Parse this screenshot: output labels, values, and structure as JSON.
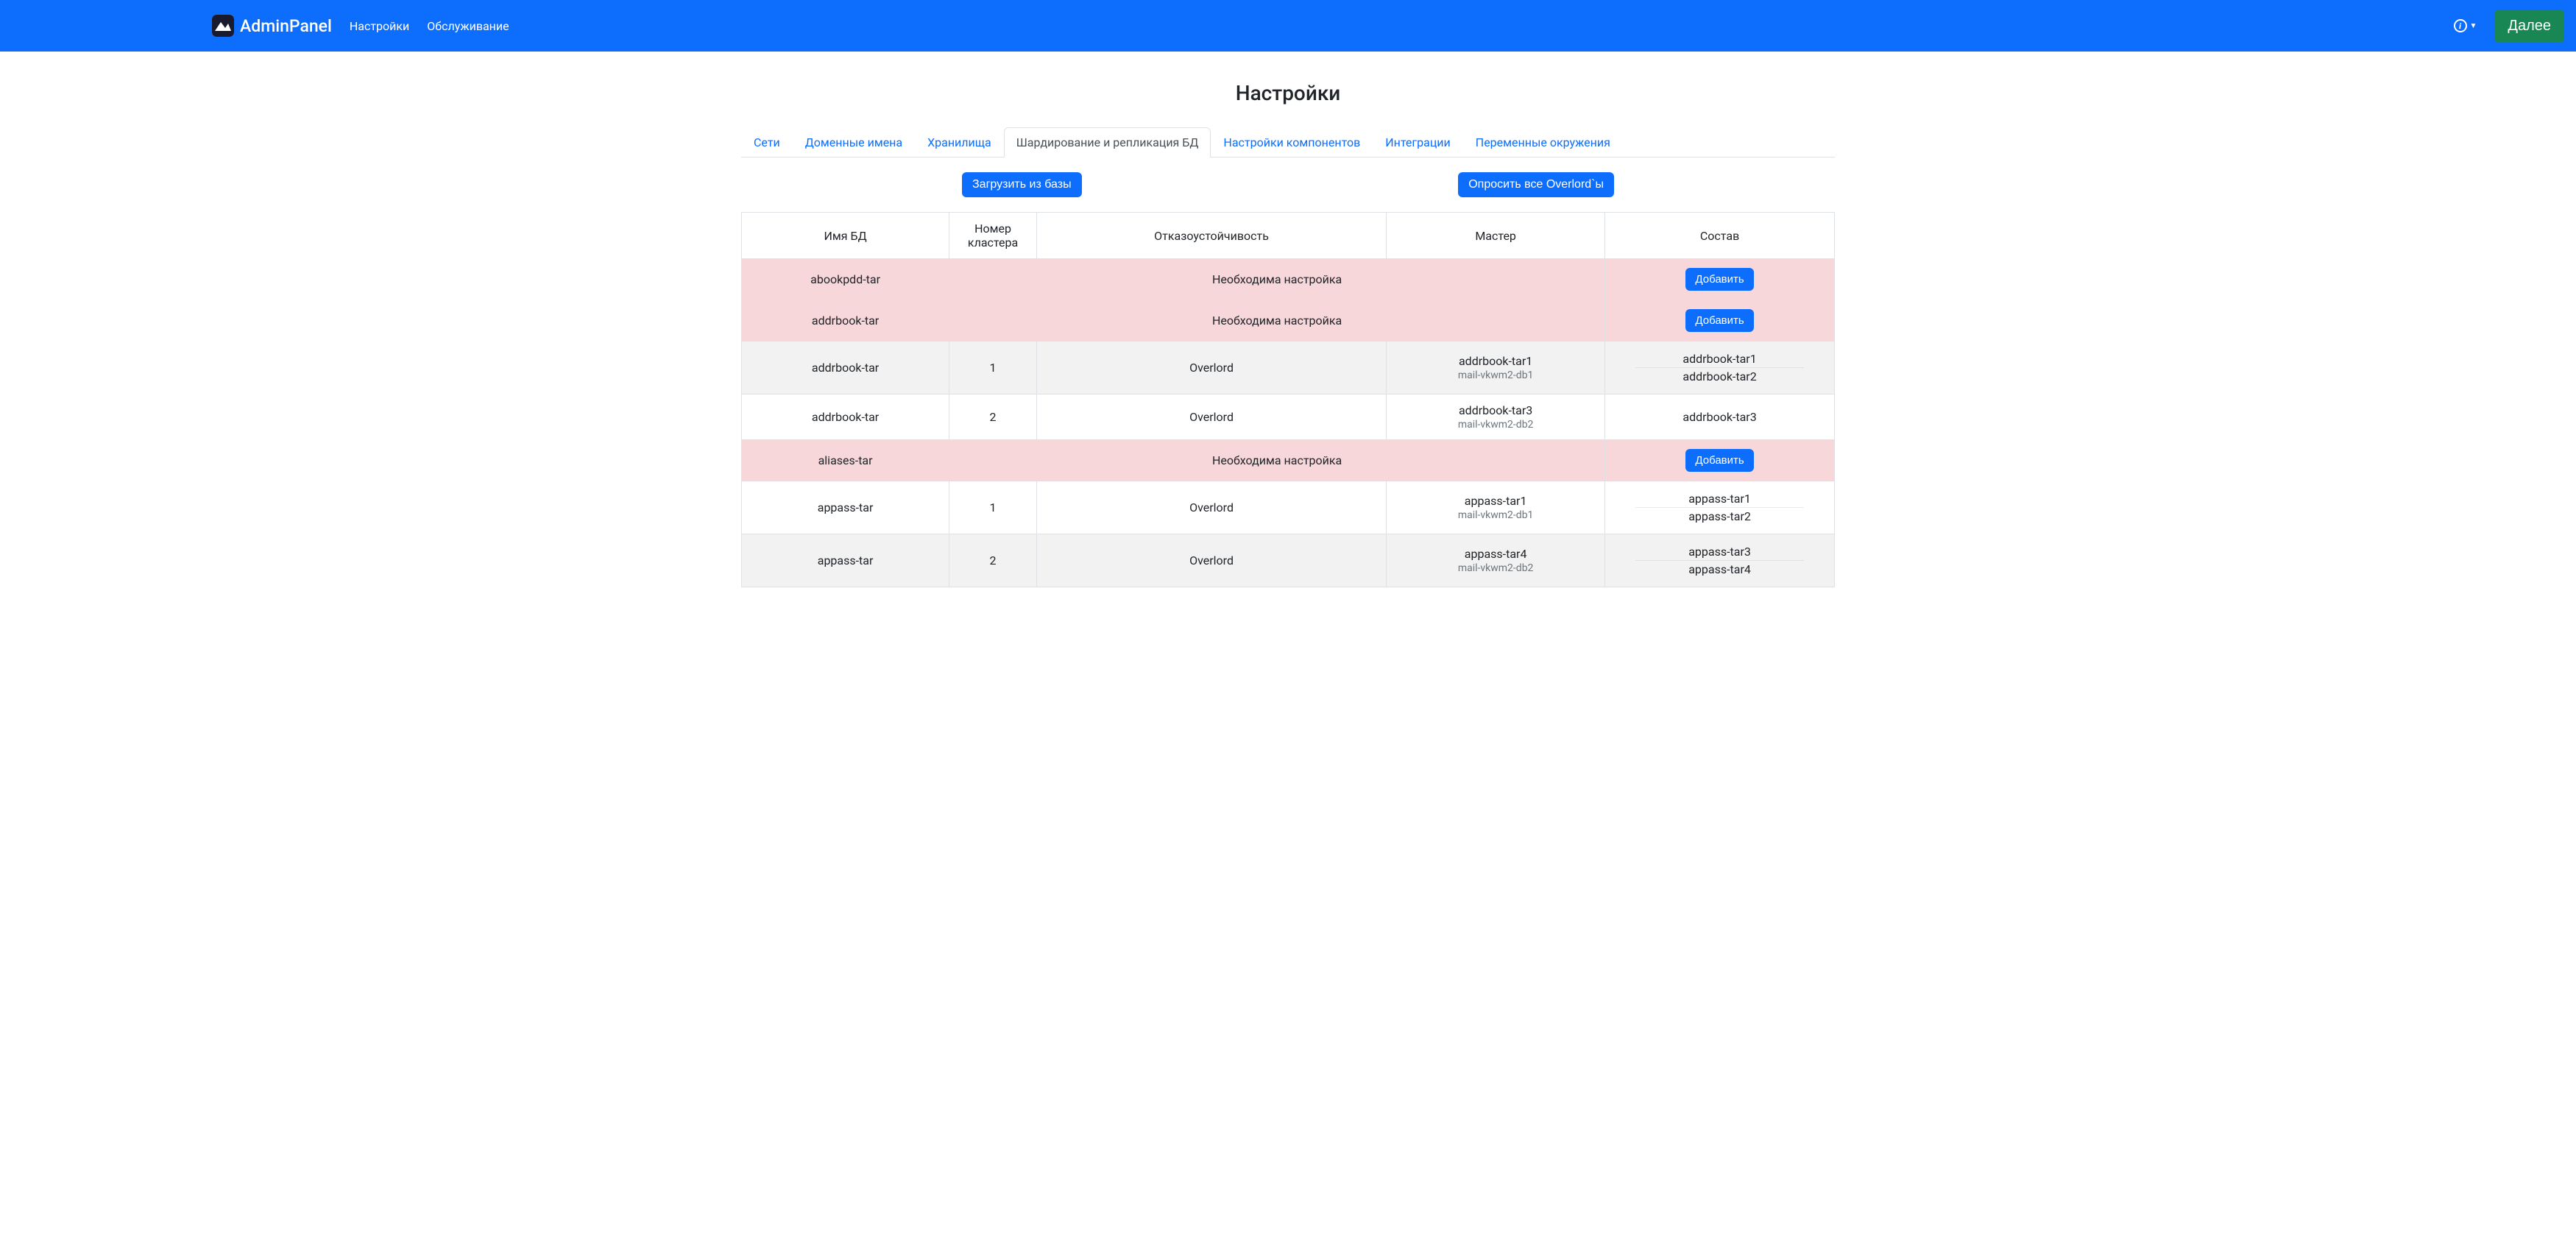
{
  "navbar": {
    "brand": "AdminPanel",
    "links": [
      "Настройки",
      "Обслуживание"
    ],
    "next_button": "Далее"
  },
  "page": {
    "title": "Настройки"
  },
  "tabs": [
    {
      "label": "Сети",
      "active": false
    },
    {
      "label": "Доменные имена",
      "active": false
    },
    {
      "label": "Хранилища",
      "active": false
    },
    {
      "label": "Шардирование и репликация БД",
      "active": true
    },
    {
      "label": "Настройки компонентов",
      "active": false
    },
    {
      "label": "Интеграции",
      "active": false
    },
    {
      "label": "Переменные окружения",
      "active": false
    }
  ],
  "actions": {
    "load_from_db": "Загрузить из базы",
    "poll_overlords": "Опросить все Overlord`ы",
    "add": "Добавить"
  },
  "table": {
    "headers": [
      "Имя БД",
      "Номер кластера",
      "Отказоустойчивость",
      "Мастер",
      "Состав"
    ],
    "rows": [
      {
        "style": "pink",
        "name": "abookpdd-tar",
        "cluster": "",
        "fault": "Необходима настройка",
        "master": "",
        "master_sub": "",
        "composition": [],
        "add_button": true
      },
      {
        "style": "pink",
        "name": "addrbook-tar",
        "cluster": "",
        "fault": "Необходима настройка",
        "master": "",
        "master_sub": "",
        "composition": [],
        "add_button": true
      },
      {
        "style": "gray",
        "name": "addrbook-tar",
        "cluster": "1",
        "fault": "Overlord",
        "master": "addrbook-tar1",
        "master_sub": "mail-vkwm2-db1",
        "composition": [
          "addrbook-tar1",
          "addrbook-tar2"
        ],
        "add_button": false
      },
      {
        "style": "white",
        "name": "addrbook-tar",
        "cluster": "2",
        "fault": "Overlord",
        "master": "addrbook-tar3",
        "master_sub": "mail-vkwm2-db2",
        "composition": [
          "addrbook-tar3"
        ],
        "add_button": false
      },
      {
        "style": "pink",
        "name": "aliases-tar",
        "cluster": "",
        "fault": "Необходима настройка",
        "master": "",
        "master_sub": "",
        "composition": [],
        "add_button": true
      },
      {
        "style": "white",
        "name": "appass-tar",
        "cluster": "1",
        "fault": "Overlord",
        "master": "appass-tar1",
        "master_sub": "mail-vkwm2-db1",
        "composition": [
          "appass-tar1",
          "appass-tar2"
        ],
        "add_button": false
      },
      {
        "style": "gray",
        "name": "appass-tar",
        "cluster": "2",
        "fault": "Overlord",
        "master": "appass-tar4",
        "master_sub": "mail-vkwm2-db2",
        "composition": [
          "appass-tar3",
          "appass-tar4"
        ],
        "add_button": false
      }
    ]
  }
}
